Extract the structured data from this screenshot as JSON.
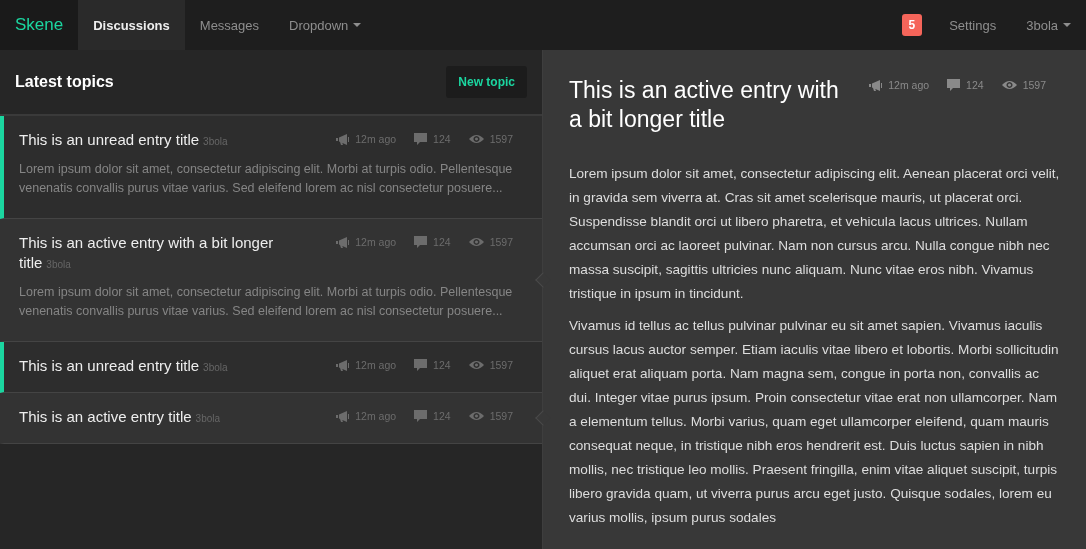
{
  "navbar": {
    "brand": "Skene",
    "tabs": [
      {
        "label": "Discussions",
        "selected": true,
        "dropdown": false
      },
      {
        "label": "Messages",
        "selected": false,
        "dropdown": false
      },
      {
        "label": "Dropdown",
        "selected": false,
        "dropdown": true
      }
    ],
    "badge": "5",
    "right_links": [
      {
        "label": "Settings",
        "dropdown": false
      },
      {
        "label": "3bola",
        "dropdown": true
      }
    ]
  },
  "topics_panel": {
    "title": "Latest topics",
    "new_button": "New topic",
    "topics": [
      {
        "title": "This is an unread entry title",
        "author": "3bola",
        "time": "12m ago",
        "comments": "124",
        "views": "1597",
        "excerpt": "Lorem ipsum dolor sit amet, consectetur adipiscing elit. Morbi at turpis odio. Pellentesque venenatis convallis purus vitae varius. Sed eleifend lorem ac nisl consectetur posuere...",
        "unread": true,
        "selected": false
      },
      {
        "title": "This is an active entry with a bit longer title",
        "author": "3bola",
        "time": "12m ago",
        "comments": "124",
        "views": "1597",
        "excerpt": "Lorem ipsum dolor sit amet, consectetur adipiscing elit. Morbi at turpis odio. Pellentesque venenatis convallis purus vitae varius. Sed eleifend lorem ac nisl consectetur posuere...",
        "unread": false,
        "selected": true
      },
      {
        "title": "This is an unread entry title",
        "author": "3bola",
        "time": "12m ago",
        "comments": "124",
        "views": "1597",
        "unread": true,
        "selected": false
      },
      {
        "title": "This is an active entry title",
        "author": "3bola",
        "time": "12m ago",
        "comments": "124",
        "views": "1597",
        "unread": false,
        "selected": true
      }
    ]
  },
  "article": {
    "title": "This is an active entry with a bit longer title",
    "time": "12m ago",
    "comments": "124",
    "views": "1597",
    "paragraphs": [
      "Lorem ipsum dolor sit amet, consectetur adipiscing elit. Aenean placerat orci velit, in gravida sem viverra at. Cras sit amet scelerisque mauris, ut placerat orci. Suspendisse blandit orci ut libero pharetra, et vehicula lacus ultrices. Nullam accumsan orci ac laoreet pulvinar. Nam non cursus arcu. Nulla congue nibh nec massa suscipit, sagittis ultricies nunc aliquam. Nunc vitae eros nibh. Vivamus tristique in ipsum in tincidunt.",
      "Vivamus id tellus ac tellus pulvinar pulvinar eu sit amet sapien. Vivamus iaculis cursus lacus auctor semper. Etiam iaculis vitae libero et lobortis. Morbi sollicitudin aliquet erat aliquam porta. Nam magna sem, congue in porta non, convallis ac dui. Integer vitae purus ipsum. Proin consectetur vitae erat non ullamcorper. Nam a elementum tellus. Morbi varius, quam eget ullamcorper eleifend, quam mauris consequat neque, in tristique nibh eros hendrerit est. Duis luctus sapien in nibh mollis, nec tristique leo mollis. Praesent fringilla, enim vitae aliquet suscipit, turpis libero gravida quam, ut viverra purus arcu eget justo. Quisque sodales, lorem eu varius mollis, ipsum purus sodales"
    ]
  }
}
